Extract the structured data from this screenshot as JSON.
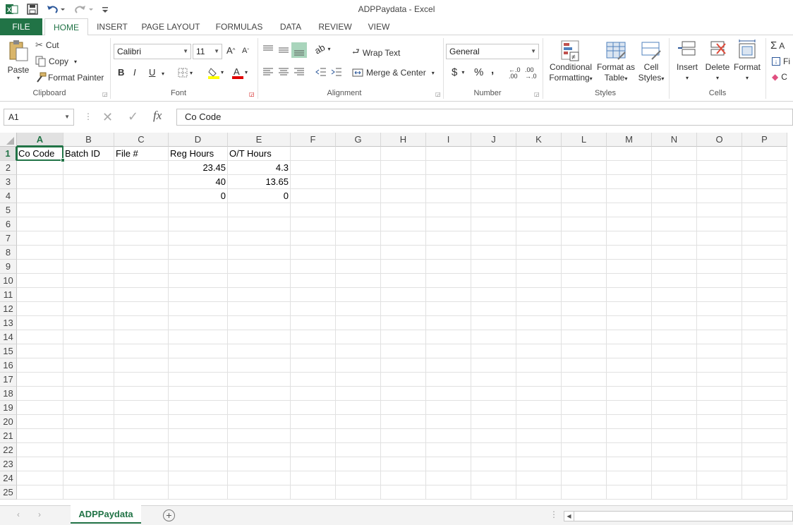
{
  "window": {
    "title": "ADPPaydata - Excel"
  },
  "ribbon_tabs": [
    "FILE",
    "HOME",
    "INSERT",
    "PAGE LAYOUT",
    "FORMULAS",
    "DATA",
    "REVIEW",
    "VIEW"
  ],
  "clipboard": {
    "paste": "Paste",
    "cut": "Cut",
    "copy": "Copy",
    "format_painter": "Format Painter",
    "label": "Clipboard"
  },
  "font": {
    "name": "Calibri",
    "size": "11",
    "bold": "B",
    "italic": "I",
    "underline": "U",
    "grow": "A",
    "shrink": "A",
    "label": "Font"
  },
  "alignment": {
    "wrap": "Wrap Text",
    "merge": "Merge & Center",
    "label": "Alignment"
  },
  "number": {
    "format": "General",
    "currency": "$",
    "percent": "%",
    "comma": ",",
    "label": "Number"
  },
  "styles": {
    "conditional_1": "Conditional",
    "conditional_2": "Formatting",
    "table_1": "Format as",
    "table_2": "Table",
    "cell_1": "Cell",
    "cell_2": "Styles",
    "label": "Styles"
  },
  "cells": {
    "insert": "Insert",
    "delete": "Delete",
    "format": "Format",
    "label": "Cells"
  },
  "editing": {
    "autosum": "A",
    "fill": "Fi",
    "clear": "C"
  },
  "formula_bar": {
    "name_box": "A1",
    "fx": "fx",
    "content": "Co Code"
  },
  "columns": [
    "A",
    "B",
    "C",
    "D",
    "E",
    "F",
    "G",
    "H",
    "I",
    "J",
    "K",
    "L",
    "M",
    "N",
    "O",
    "P"
  ],
  "rows": [
    "1",
    "2",
    "3",
    "4",
    "5",
    "6",
    "7",
    "8",
    "9",
    "10",
    "11",
    "12",
    "13",
    "14",
    "15",
    "16",
    "17",
    "18",
    "19",
    "20",
    "21",
    "22",
    "23",
    "24",
    "25"
  ],
  "sheet": {
    "A1": "Co Code",
    "B1": "Batch ID",
    "C1": "File #",
    "D1": "Reg Hours",
    "E1": "O/T Hours",
    "D2": "23.45",
    "E2": "4.3",
    "D3": "40",
    "E3": "13.65",
    "D4": "0",
    "E4": "0"
  },
  "sheet_tabs": [
    "ADPPaydata"
  ],
  "accent": "#217346"
}
